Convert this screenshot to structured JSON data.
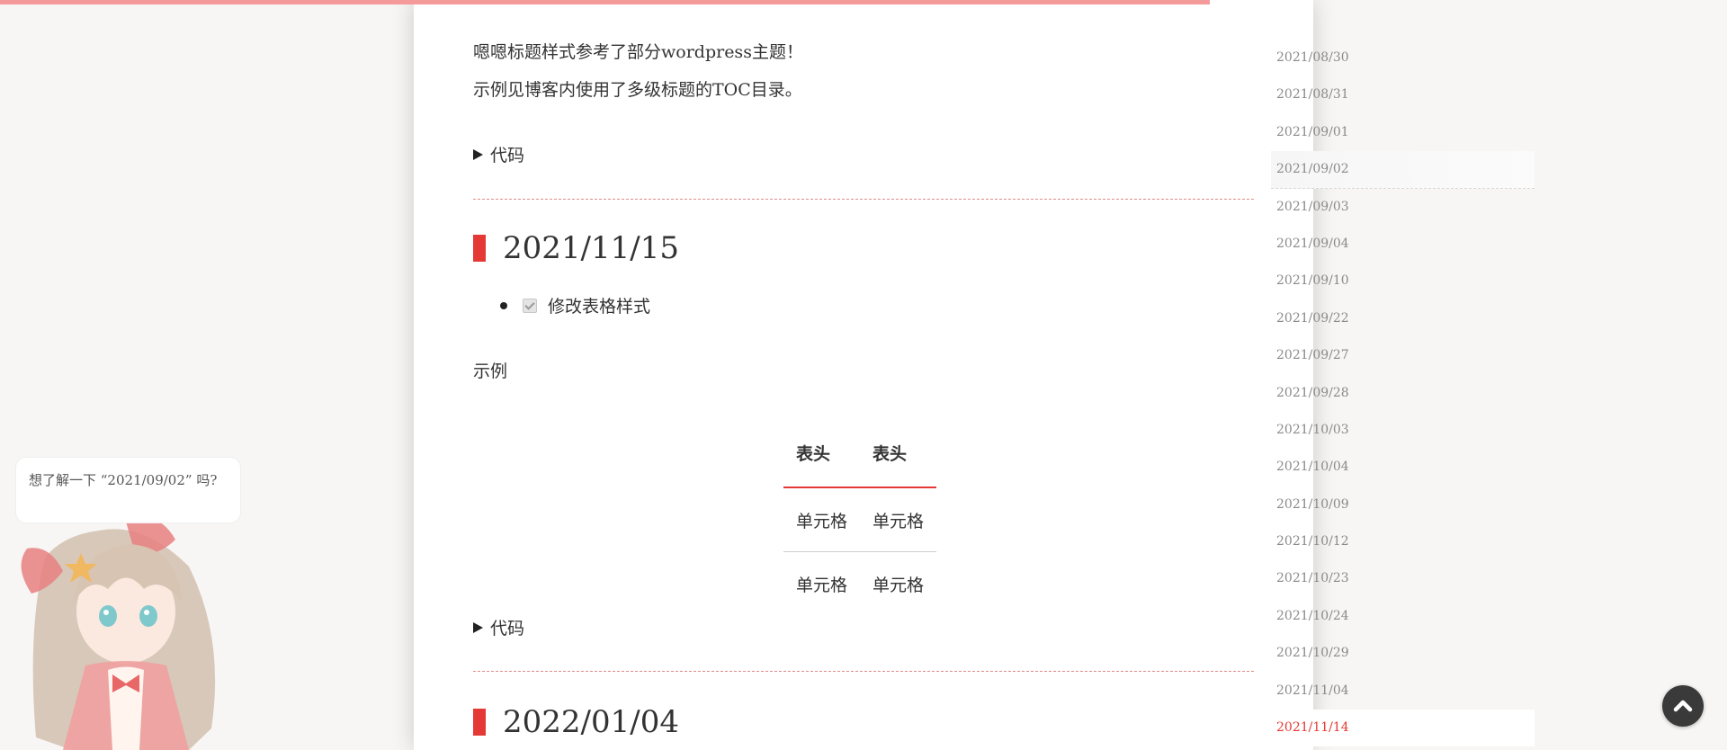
{
  "article": {
    "intro_line1": "嗯嗯标题样式参考了部分wordpress主题！",
    "intro_line2": "示例见博客内使用了多级标题的TOC目录。",
    "code_summary_1": "代码",
    "section1": {
      "date": "2021/11/15",
      "task": "修改表格样式",
      "task_done": true,
      "example_label": "示例",
      "table": {
        "headers": [
          "表头",
          "表头"
        ],
        "rows": [
          [
            "单元格",
            "单元格"
          ],
          [
            "单元格",
            "单元格"
          ]
        ]
      },
      "code_summary": "代码"
    },
    "section2": {
      "date": "2022/01/04"
    }
  },
  "toc": {
    "items": [
      "2021/08/30",
      "2021/08/31",
      "2021/09/01",
      "2021/09/02",
      "2021/09/03",
      "2021/09/04",
      "2021/09/10",
      "2021/09/22",
      "2021/09/27",
      "2021/09/28",
      "2021/10/03",
      "2021/10/04",
      "2021/10/09",
      "2021/10/12",
      "2021/10/23",
      "2021/10/24",
      "2021/10/29",
      "2021/11/04",
      "2021/11/14"
    ],
    "hovered": "2021/09/02",
    "active": "2021/11/14"
  },
  "waifu": {
    "tip": "想了解一下 “2021/09/02” 吗?"
  },
  "icons": {
    "back_to_top": "chevron-up-icon",
    "summary_marker": "triangle-right-icon",
    "heading_marker": "red-bar-icon"
  },
  "colors": {
    "accent": "#e53935",
    "progress": "#f49a9a",
    "divider": "#e08b8b",
    "toc_text": "#8a8a8a"
  }
}
